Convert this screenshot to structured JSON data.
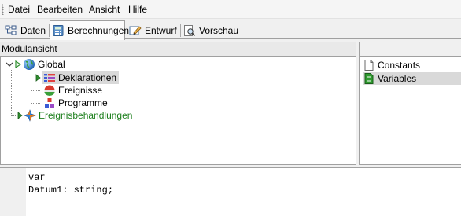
{
  "menu": {
    "items": [
      {
        "label": "Datei"
      },
      {
        "label": "Bearbeiten"
      },
      {
        "label": "Ansicht"
      },
      {
        "label": "Hilfe"
      }
    ]
  },
  "tabs": [
    {
      "label": "Daten",
      "icon": "data-icon",
      "active": false
    },
    {
      "label": "Berechnungen",
      "icon": "calculator-icon",
      "active": true
    },
    {
      "label": "Entwurf",
      "icon": "design-pencil-icon",
      "active": false
    },
    {
      "label": "Vorschau",
      "icon": "preview-magnifier-icon",
      "active": false
    }
  ],
  "module_view": {
    "title": "Modulansicht",
    "tree": {
      "root": {
        "label": "Global",
        "icon": "globe-icon"
      },
      "children": [
        {
          "label": "Deklarationen",
          "icon": "declarations-icon",
          "selected": true
        },
        {
          "label": "Ereignisse",
          "icon": "events-icon"
        },
        {
          "label": "Programme",
          "icon": "programs-icon"
        }
      ],
      "event_handlers": {
        "label": "Ereignisbehandlungen",
        "icon": "event-handlers-icon",
        "color": "#1a7e1a"
      }
    }
  },
  "declarations_list": {
    "items": [
      {
        "label": "Constants",
        "icon": "document-icon",
        "selected": false
      },
      {
        "label": "Variables",
        "icon": "green-document-icon",
        "selected": true
      }
    ]
  },
  "editor": {
    "lines": [
      "var",
      "Datum1: string;"
    ]
  },
  "colors": {
    "selection": "#d9d9d9",
    "event_handlers_text": "#1a7e1a",
    "accent_green": "#2f8f2f"
  }
}
